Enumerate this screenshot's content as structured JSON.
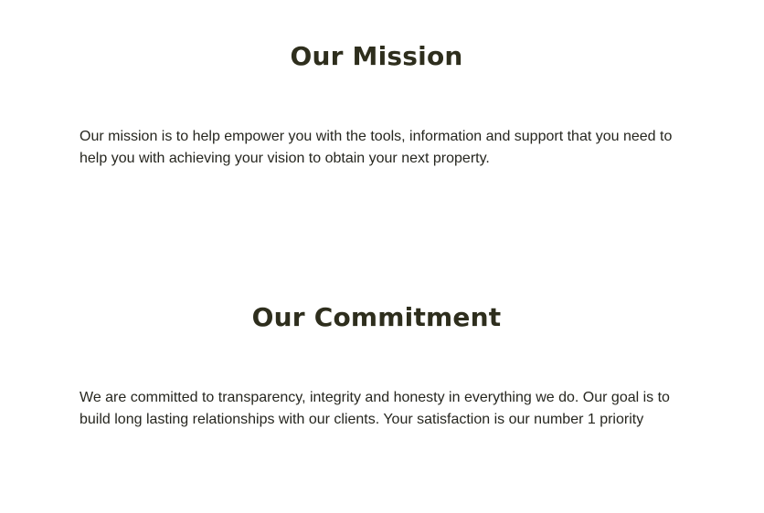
{
  "mission": {
    "title": "Our Mission",
    "text": "Our mission is to help empower you with the tools, information and support that you need to help you with achieving your vision to obtain your next property."
  },
  "commitment": {
    "title": "Our Commitment",
    "text": "We are committed to transparency, integrity and honesty in everything we do. Our goal is to build long lasting relationships with our clients. Your satisfaction is our number 1 priority"
  }
}
